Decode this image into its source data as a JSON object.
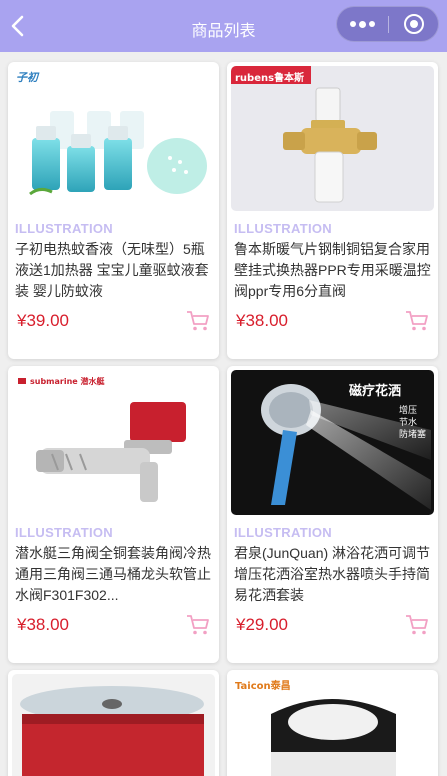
{
  "nav": {
    "title": "商品列表"
  },
  "products": [
    {
      "brand": "子初",
      "tag": "ILLUSTRATION",
      "name": "子初电热蚊香液（无味型）5瓶液送1加热器 宝宝儿童驱蚊液套装 婴儿防蚊液",
      "price": "¥39.00"
    },
    {
      "brand": "rubens鲁本斯",
      "tag": "ILLUSTRATION",
      "name": "鲁本斯暖气片钢制铜铝复合家用壁挂式换热器PPR专用采暖温控阀ppr专用6分直阀",
      "price": "¥38.00"
    },
    {
      "brand": "submarine 潜水艇",
      "tag": "ILLUSTRATION",
      "name": "潜水艇三角阀全铜套装角阀冷热通用三角阀三通马桶龙头软管止水阀F301F302...",
      "price": "¥38.00"
    },
    {
      "brand": "磁疗花洒",
      "brand_sub": [
        "增压",
        "节水",
        "防堵塞"
      ],
      "tag": "ILLUSTRATION",
      "name": "君泉(JunQuan) 淋浴花洒可调节增压花洒浴室热水器喷头手持简易花洒套装",
      "price": "¥29.00"
    },
    {
      "brand": "",
      "tag": "",
      "name": "",
      "price": ""
    },
    {
      "brand": "Taicon泰昌",
      "tag": "",
      "name": "",
      "price": ""
    }
  ]
}
